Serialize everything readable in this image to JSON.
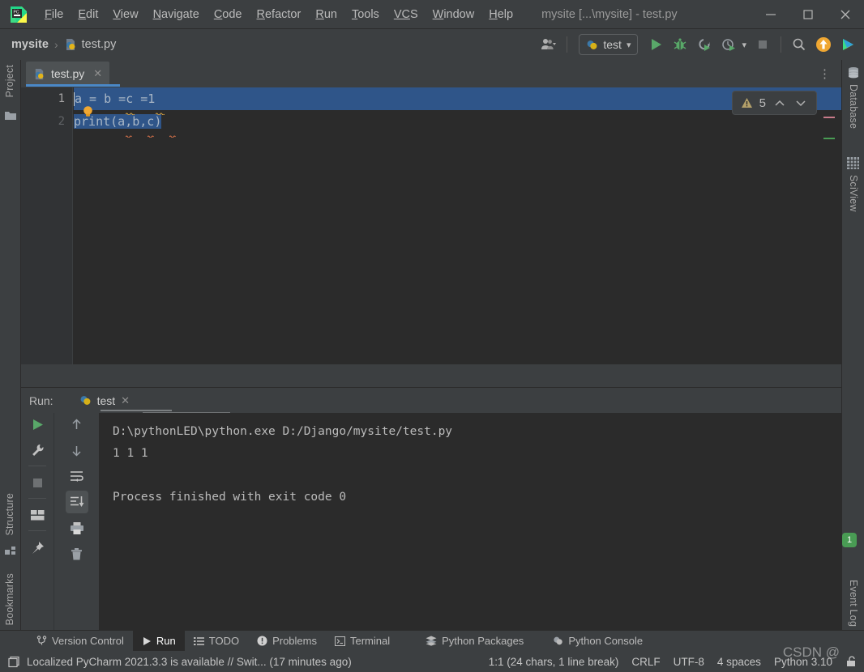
{
  "window": {
    "title": "mysite [...\\mysite] - test.py",
    "minimize": "—",
    "maximize": "□",
    "close": "✕"
  },
  "menu": {
    "logo_icon": "pycharm-logo-icon",
    "items": [
      {
        "label": "File",
        "mnemonic": "F",
        "rest": "ile"
      },
      {
        "label": "Edit",
        "mnemonic": "E",
        "rest": "dit"
      },
      {
        "label": "View",
        "mnemonic": "V",
        "rest": "iew"
      },
      {
        "label": "Navigate",
        "mnemonic": "N",
        "rest": "avigate"
      },
      {
        "label": "Code",
        "mnemonic": "C",
        "rest": "ode"
      },
      {
        "label": "Refactor",
        "mnemonic": "R",
        "rest": "efactor"
      },
      {
        "label": "Run",
        "mnemonic": "R",
        "rest": "un"
      },
      {
        "label": "Tools",
        "mnemonic": "T",
        "rest": "ools"
      },
      {
        "label": "VCS",
        "mnemonic": "VC",
        "rest": "S"
      },
      {
        "label": "Window",
        "mnemonic": "W",
        "rest": "indow"
      },
      {
        "label": "Help",
        "mnemonic": "H",
        "rest": "elp"
      }
    ]
  },
  "toolbar": {
    "breadcrumb_project": "mysite",
    "breadcrumb_sep": "›",
    "breadcrumb_file": "test.py",
    "file_icon": "python-file-icon",
    "user_icon": "user-account-icon",
    "run_config": "test",
    "run_config_icon": "python-icon",
    "run_config_caret": "▾",
    "run_icon": "run-icon",
    "debug_icon": "debug-bug-icon",
    "coverage_icon": "run-with-coverage-icon",
    "profile_icon": "profile-icon",
    "profile_caret": "▾",
    "stop_icon": "stop-icon",
    "search_icon": "search-icon",
    "update_icon": "update-project-icon",
    "plugin_icon": "ide-services-icon"
  },
  "left_strip": {
    "project_label": "Project",
    "project_icon": "folder-icon",
    "structure_label": "Structure",
    "structure_icon": "structure-icon",
    "bookmarks_label": "Bookmarks",
    "bookmarks_icon": "bookmark-icon"
  },
  "right_strip": {
    "database_label": "Database",
    "database_icon": "database-icon",
    "sciview_label": "SciView",
    "sciview_icon": "sciview-grid-icon",
    "eventlog_label": "Event Log",
    "eventlog_badge": "1"
  },
  "editor": {
    "tab_label": "test.py",
    "tab_icon": "python-file-icon",
    "tab_close": "✕",
    "kebab": "⋮",
    "line_numbers": [
      "1",
      "2"
    ],
    "line1_code": "a = b =c =1",
    "line2_code": "print(a,b,c)",
    "bulb_icon": "intention-bulb-icon",
    "inspection_icon": "warning-triangle-icon",
    "inspection_count": "5",
    "inspection_prev": "⌃",
    "inspection_next": "⌄",
    "marker_colors": [
      "#c87b8a",
      "#499c54"
    ]
  },
  "run_window": {
    "label": "Run:",
    "tab_label": "test",
    "tab_icon": "python-icon",
    "tab_close": "✕",
    "settings_icon": "gear-icon",
    "minimize_icon": "minimize-icon",
    "left_buttons": [
      {
        "name": "rerun-icon"
      },
      {
        "name": "wrench-settings-icon"
      },
      {
        "name": "stop-icon"
      },
      {
        "name": "layout-icon"
      },
      {
        "name": "pin-icon"
      }
    ],
    "right_buttons": [
      {
        "name": "up-arrow-icon"
      },
      {
        "name": "down-arrow-icon"
      },
      {
        "name": "soft-wrap-icon"
      },
      {
        "name": "scroll-to-end-icon"
      },
      {
        "name": "print-icon"
      },
      {
        "name": "trash-icon"
      }
    ],
    "console_lines": [
      "D:\\pythonLED\\python.exe D:/Django/mysite/test.py",
      "1 1 1",
      "",
      "Process finished with exit code 0"
    ]
  },
  "bottom_tabs": [
    {
      "label": "Version Control",
      "icon": "branch-icon",
      "active": false
    },
    {
      "label": "Run",
      "icon": "run-icon",
      "active": true
    },
    {
      "label": "TODO",
      "icon": "todo-list-icon",
      "active": false
    },
    {
      "label": "Problems",
      "icon": "problems-icon",
      "active": false
    },
    {
      "label": "Terminal",
      "icon": "terminal-icon",
      "active": false
    },
    {
      "label": "Python Packages",
      "icon": "packages-icon",
      "active": false
    },
    {
      "label": "Python Console",
      "icon": "python-icon",
      "active": false
    }
  ],
  "statusbar": {
    "message_icon": "notification-icon",
    "message": "Localized PyCharm 2021.3.3 is available // Swit... (17 minutes ago)",
    "caret_position": "1:1 (24 chars, 1 line break)",
    "line_separator": "CRLF",
    "encoding": "UTF-8",
    "indent": "4 spaces",
    "interpreter": "Python 3.10",
    "lock_icon": "read-only-lock-icon"
  },
  "watermark": "CSDN @",
  "colors": {
    "accent_blue": "#4a88c7",
    "selection_blue": "#2f5589",
    "green": "#499c54",
    "orange": "#f0a732",
    "editor_bg": "#2b2b2b",
    "chrome_bg": "#3c3f41"
  }
}
